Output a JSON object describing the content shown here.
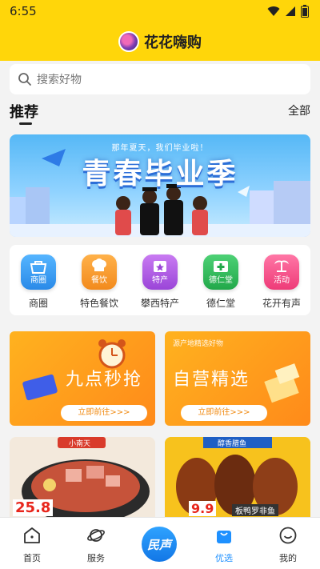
{
  "status": {
    "time": "6:55"
  },
  "app": {
    "title": "花花嗨购"
  },
  "search": {
    "placeholder": "搜索好物"
  },
  "section": {
    "title": "推荐",
    "more": "全部"
  },
  "banner": {
    "subtitle": "那年夏天，我们毕业啦！",
    "title": "青春毕业季"
  },
  "categories": [
    {
      "icon": "shop-icon",
      "icon_text": "商圈",
      "label": "商圈",
      "color": "#3aa3f5"
    },
    {
      "icon": "chef-hat-icon",
      "icon_text": "餐饮",
      "label": "特色餐饮",
      "color": "#f59a2a"
    },
    {
      "icon": "star-bag-icon",
      "icon_text": "特产",
      "label": "攀西特产",
      "color": "#b45be6"
    },
    {
      "icon": "medical-kit-icon",
      "icon_text": "德仁堂",
      "label": "德仁堂",
      "color": "#2fbf5a"
    },
    {
      "icon": "palm-tree-icon",
      "icon_text": "活动",
      "label": "花开有声",
      "color": "#f54f8a"
    }
  ],
  "promos": [
    {
      "title": "九点秒抢",
      "subtitle": "",
      "button": "立即前往>>>"
    },
    {
      "title": "自营精选",
      "subtitle": "源产地精选好物",
      "button": "立即前往>>>"
    }
  ],
  "food_cards": [
    {
      "tag": "小南天",
      "price": "25.8"
    },
    {
      "tag": "醇香腊鱼",
      "price": "9.9",
      "caption": "板鸭罗非鱼"
    }
  ],
  "tabs": [
    {
      "label": "首页",
      "icon": "home-icon",
      "active": false
    },
    {
      "label": "服务",
      "icon": "planet-icon",
      "active": false
    },
    {
      "label": "民声",
      "icon": "minsheng-logo-icon",
      "active": false
    },
    {
      "label": "优选",
      "icon": "shopping-bag-icon",
      "active": true
    },
    {
      "label": "我的",
      "icon": "profile-smile-icon",
      "active": false
    }
  ],
  "colors": {
    "brand_yellow": "#ffd60a",
    "active_tab": "#1e90ff"
  }
}
